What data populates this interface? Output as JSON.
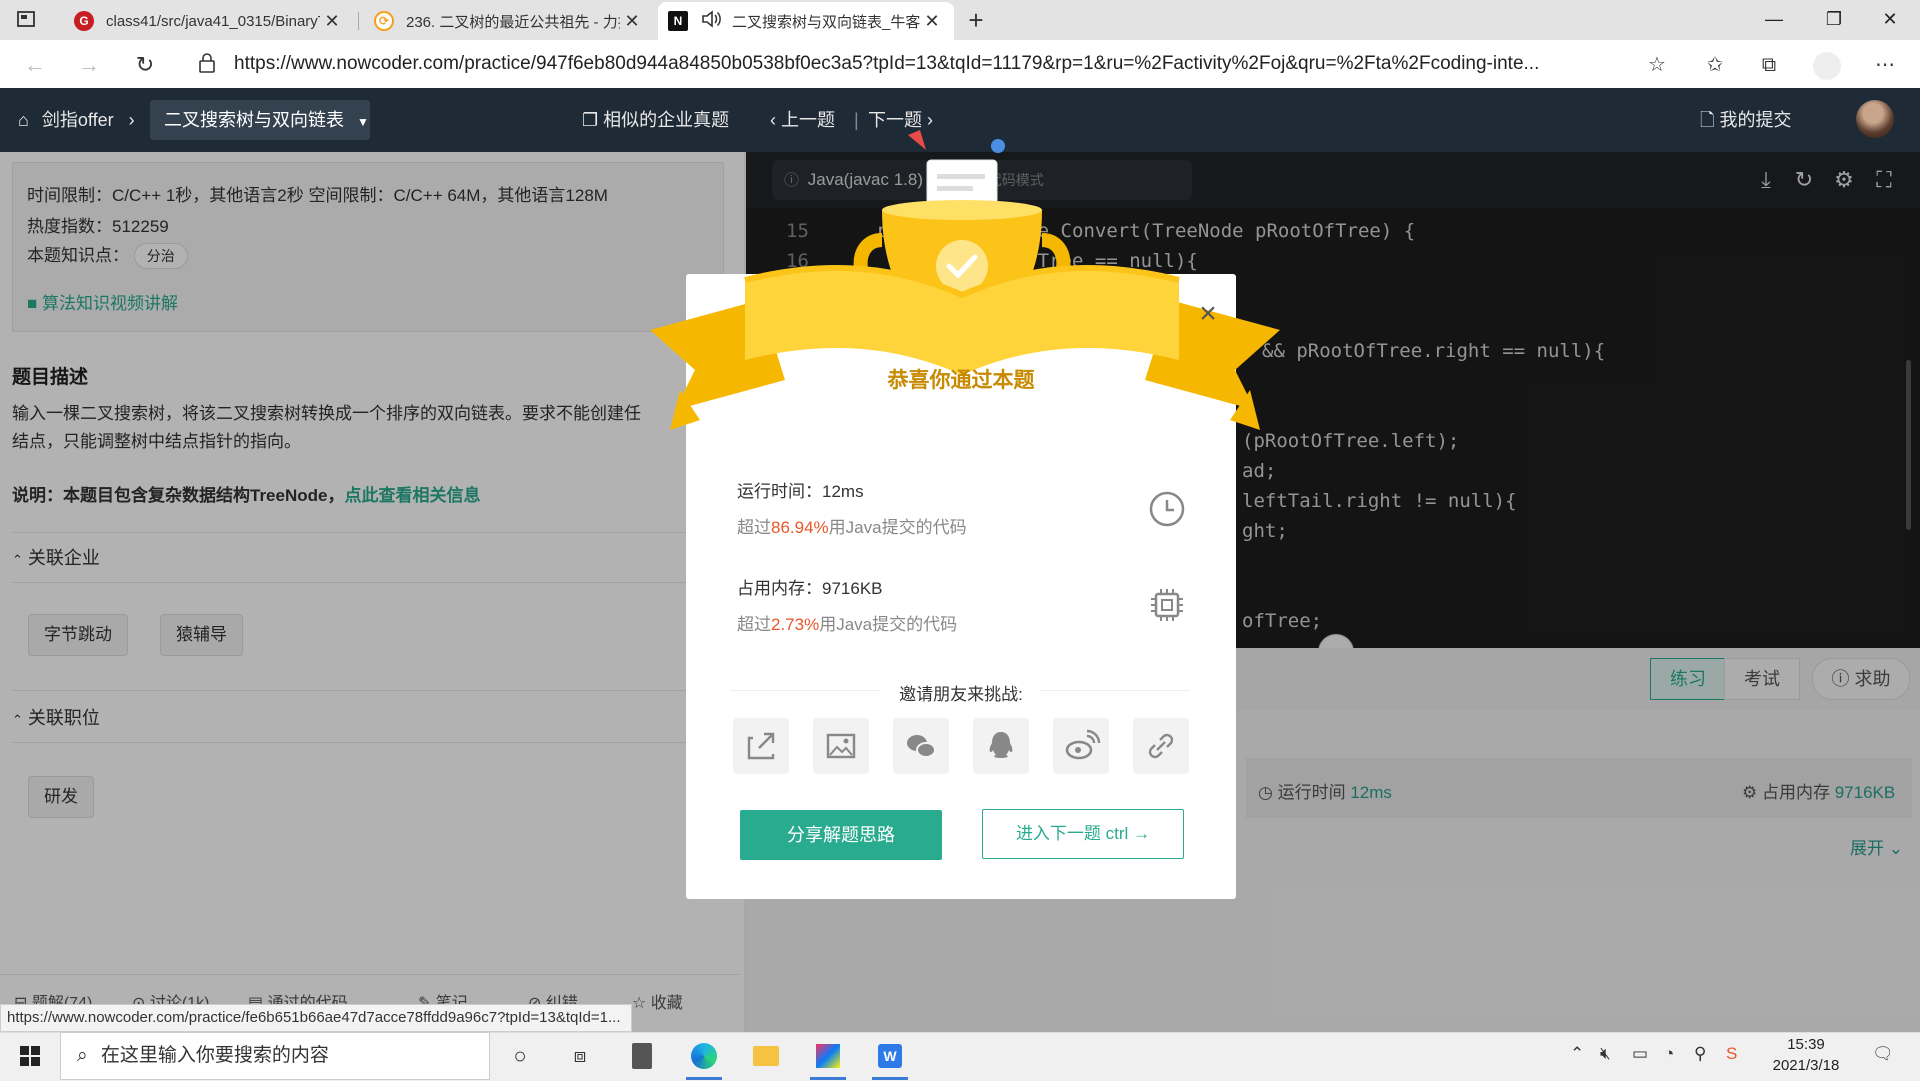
{
  "browser": {
    "tabs": [
      {
        "title": "class41/src/java41_0315/BinaryTr",
        "icon": "gitee-icon"
      },
      {
        "title": "236. 二叉树的最近公共祖先 - 力扣",
        "icon": "leetcode-icon"
      },
      {
        "title": "二叉搜索树与双向链表_牛客",
        "icon": "nowcoder-icon",
        "active": true,
        "audio": true
      }
    ],
    "url": "https://www.nowcoder.com/practice/947f6eb80d944a84850b0538bf0ec3a5?tpId=13&tqId=11179&rp=1&ru=%2Factivity%2Foj&qru=%2Fta%2Fcoding-inte..."
  },
  "header": {
    "home": "剑指offer",
    "topic": "二叉搜索树与双向链表",
    "similar": "相似的企业真题",
    "prev": "上一题",
    "next": "下一题",
    "my_submissions": "我的提交"
  },
  "problem": {
    "limits": "时间限制：C/C++ 1秒，其他语言2秒    空间限制：C/C++ 64M，其他语言128M",
    "heat": "热度指数：512259",
    "knowledge_label": "本题知识点：",
    "knowledge_tag": "分治",
    "video_link": "算法知识视频讲解",
    "desc_title": "题目描述",
    "desc_line1": "输入一棵二叉搜索树，将该二叉搜索树转换成一个排序的双向链表。要求不能创建任",
    "desc_line2": "结点，只能调整树中结点指针的指向。",
    "note_prefix": "说明：本题目包含复杂数据结构TreeNode，",
    "note_link": "点此查看相关信息",
    "companies_title": "关联企业",
    "companies": [
      "字节跳动",
      "猿辅导"
    ],
    "jobs_title": "关联职位",
    "jobs": [
      "研发"
    ],
    "bottom_actions": [
      "题解(74)",
      "讨论(1k)",
      "通过的代码",
      "笔记",
      "纠错",
      "收藏"
    ]
  },
  "editor": {
    "language": "Java(javac 1.8)",
    "mode": "代码模式",
    "code": [
      {
        "n": "15",
        "t": "    public TreeNode Convert(TreeNode pRootOfTree) {"
      },
      {
        "n": "16",
        "t": "        if(pRootOfTree == null){"
      },
      {
        "n": "",
        "t": "&& pRootOfTree.right == null){"
      },
      {
        "n": "",
        "t": "(pRootOfTree.left);"
      },
      {
        "n": "",
        "t": "ad;"
      },
      {
        "n": "",
        "t": "leftTail.right != null){"
      },
      {
        "n": "",
        "t": "ght;"
      },
      {
        "n": "",
        "t": "ofTree;"
      }
    ],
    "modes": {
      "practice": "练习",
      "exam": "考试",
      "help": "求助"
    },
    "result": {
      "runtime_label": "运行时间",
      "runtime": "12ms",
      "memory_label": "占用内存",
      "memory": "9716KB",
      "expand": "展开"
    }
  },
  "modal": {
    "title": "恭喜你通过本题",
    "runtime_label": "运行时间：",
    "runtime": "12ms",
    "runtime_beat_prefix": "超过",
    "runtime_beat": "86.94%",
    "runtime_beat_suffix": "用Java提交的代码",
    "memory_label": "占用内存：",
    "memory": "9716KB",
    "memory_beat_prefix": "超过",
    "memory_beat": "2.73%",
    "memory_beat_suffix": "用Java提交的代码",
    "invite": "邀请朋友来挑战:",
    "share_icons": [
      "external-share-icon",
      "image-icon",
      "wechat-icon",
      "qq-icon",
      "weibo-icon",
      "link-icon"
    ],
    "share_button": "分享解题思路",
    "next_button": "进入下一题 ctrl",
    "accent": "#29ab8f",
    "highlight": "#e8572a"
  },
  "status_url": "https://www.nowcoder.com/practice/fe6b651b66ae47d7acce78ffdd9a96c7?tpId=13&tqId=1...",
  "taskbar": {
    "search_placeholder": "在这里输入你要搜索的内容",
    "time": "15:39",
    "date": "2021/3/18"
  }
}
